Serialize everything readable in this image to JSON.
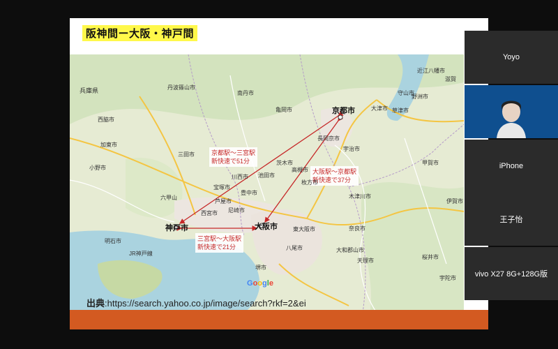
{
  "slide": {
    "title": "阪神間ー大阪・神戸間",
    "source_label": "出典",
    "source_url": ":https://search.yahoo.co.jp/image/search?rkf=2&ei"
  },
  "map": {
    "cities": {
      "kyoto": "京都市",
      "osaka": "大阪市",
      "kobe": "神戸市"
    },
    "routes": [
      {
        "line1": "京都駅〜三宮駅",
        "line2": "新快速で51分"
      },
      {
        "line1": "大阪駅〜京都駅",
        "line2": "新快速で37分"
      },
      {
        "line1": "三宮駅〜大阪駅",
        "line2": "新快速で21分"
      }
    ],
    "labels": [
      "兵庫県",
      "丹波篠山市",
      "亀岡市",
      "西脇市",
      "加東市",
      "小野市",
      "三田市",
      "宝塚市",
      "川西市",
      "豊中市",
      "西宮市",
      "尼崎市",
      "明石市",
      "高槻市",
      "枚方市",
      "東大阪市",
      "八尾市",
      "堺市",
      "奈良市",
      "大和郡山市",
      "天理市",
      "宇治市",
      "木津川市",
      "大津市",
      "草津市",
      "甲賀市",
      "伊賀市",
      "桜井市",
      "宇陀市",
      "滋賀",
      "近江八幡市",
      "南丹市",
      "長岡京市",
      "茨木市",
      "池田市",
      "芦屋市",
      "守山市",
      "野洲市",
      "JR神戸線",
      "六甲山"
    ],
    "attribution": "Google"
  },
  "participants": [
    {
      "name": "Yoyo"
    },
    {
      "name": ""
    },
    {
      "name": "iPhone"
    },
    {
      "name": "王子怡"
    },
    {
      "name": "vivo X27 8G+128G版"
    }
  ],
  "colors": {
    "title_highlight": "#fff84a",
    "route_red": "#c62828",
    "bar_orange": "#d35a21",
    "water": "#aad3df",
    "land": "#e9edd8"
  }
}
